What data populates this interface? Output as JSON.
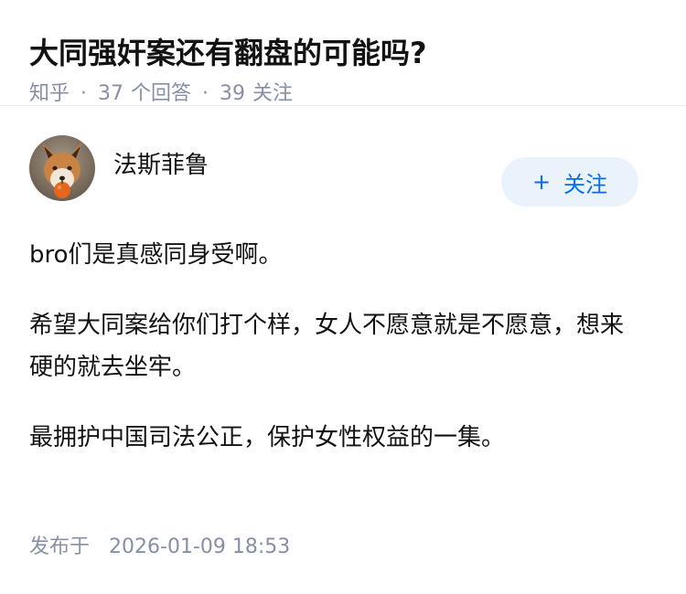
{
  "question": {
    "title": "大同强奸案还有翻盘的可能吗?",
    "source": "知乎",
    "separator": "·",
    "answer_count": "37",
    "answer_label": "个回答",
    "follower_count": "39",
    "follower_label": "关注"
  },
  "answer": {
    "author": {
      "name": "法斯菲鲁",
      "avatar_icon": "fox-avatar-icon"
    },
    "follow_button": {
      "icon": "+",
      "label": "关注"
    },
    "paragraphs": [
      "bro们是真感同身受啊。",
      "希望大同案给你们打个样，女人不愿意就是不愿意，想来硬的就去坐牢。",
      "最拥护中国司法公正，保护女性权益的一集。"
    ],
    "publish_label": "发布于",
    "publish_time": "2026-01-09 18:53"
  },
  "colors": {
    "meta_gray": "#8590a6",
    "accent_blue": "#056de8",
    "button_bg": "#eaf3fc",
    "text": "#121212"
  }
}
